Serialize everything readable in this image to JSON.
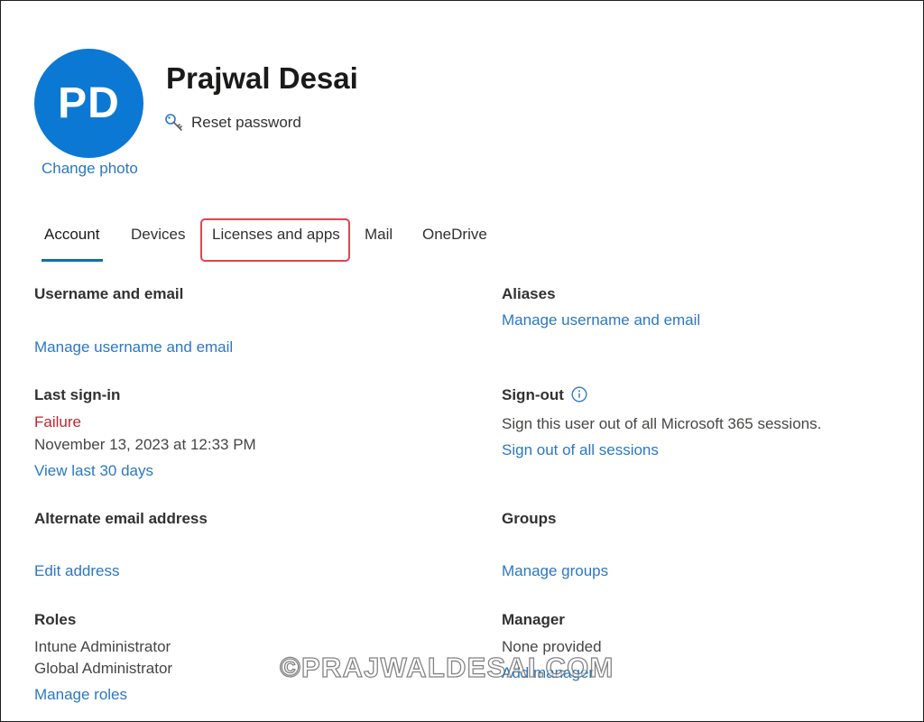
{
  "profile": {
    "initials": "PD",
    "name": "Prajwal Desai",
    "change_photo": "Change photo",
    "reset_password": "Reset password",
    "avatar_color": "#0b78d4"
  },
  "tabs": [
    {
      "label": "Account",
      "active": true
    },
    {
      "label": "Devices"
    },
    {
      "label": "Licenses and apps",
      "highlighted": true
    },
    {
      "label": "Mail"
    },
    {
      "label": "OneDrive"
    }
  ],
  "sections": {
    "username": {
      "heading": "Username and email",
      "link": "Manage username and email"
    },
    "aliases": {
      "heading": "Aliases",
      "link": "Manage username and email"
    },
    "last_signin": {
      "heading": "Last sign-in",
      "status": "Failure",
      "timestamp": "November 13, 2023 at 12:33 PM",
      "link": "View last 30 days"
    },
    "signout": {
      "heading": "Sign-out",
      "description": "Sign this user out of all Microsoft 365 sessions.",
      "link": "Sign out of all sessions"
    },
    "alternate_email": {
      "heading": "Alternate email address",
      "link": "Edit address"
    },
    "groups": {
      "heading": "Groups",
      "link": "Manage groups"
    },
    "roles": {
      "heading": "Roles",
      "items": [
        "Intune Administrator",
        "Global Administrator"
      ],
      "link": "Manage roles"
    },
    "manager": {
      "heading": "Manager",
      "value": "None provided",
      "link": "Add manager"
    }
  },
  "watermark": "©PRAJWALDESAI.COM",
  "colors": {
    "link": "#2b78c4",
    "failure": "#c4262e",
    "highlight": "#e0444f",
    "tab_underline": "#0f6cbd"
  }
}
